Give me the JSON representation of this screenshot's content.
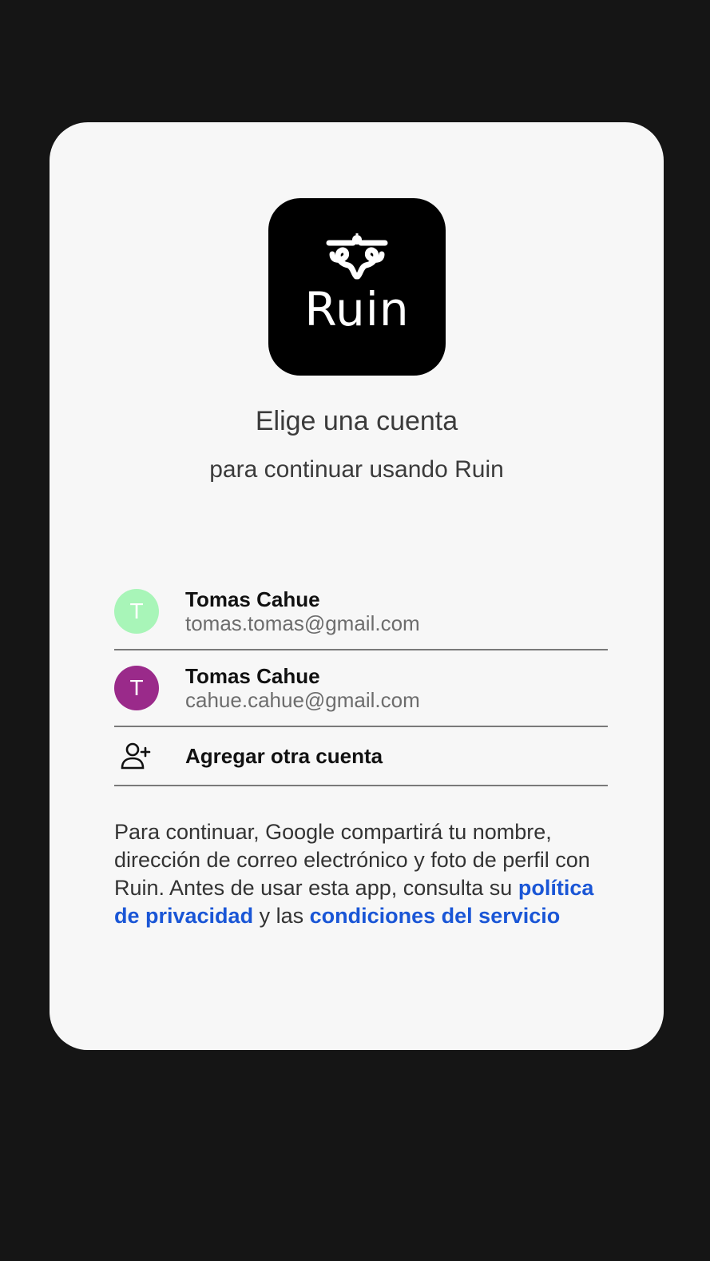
{
  "app": {
    "logo_text": "Ruin"
  },
  "header": {
    "title": "Elige una cuenta",
    "subtitle": "para continuar usando Ruin"
  },
  "accounts": [
    {
      "initial": "T",
      "name": "Tomas Cahue",
      "email": "tomas.tomas@gmail.com",
      "avatar_color": "#a8f5b8"
    },
    {
      "initial": "T",
      "name": "Tomas Cahue",
      "email": "cahue.cahue@gmail.com",
      "avatar_color": "#9a2a8a"
    }
  ],
  "add_account": {
    "label": "Agregar otra cuenta",
    "icon": "add-person-icon"
  },
  "disclaimer": {
    "text": "Para continuar, Google compartirá tu nombre, dirección de correo electrónico y foto de perfil con Ruin. Antes de usar esta app, consulta su",
    "privacy_link": "política de privacidad",
    "connector": "y las",
    "terms_link": "condiciones del servicio"
  },
  "colors": {
    "background": "#151515",
    "card": "#f7f7f7",
    "link": "#1a56d6"
  }
}
